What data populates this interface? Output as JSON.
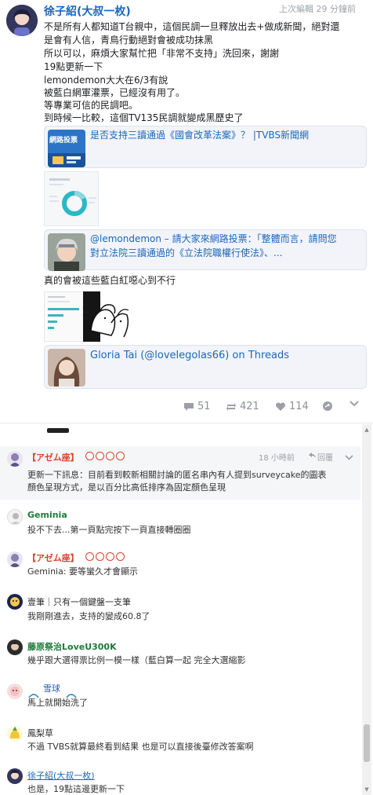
{
  "post": {
    "author": "徐子紹(大叔一枚)",
    "edited": "上次編輯 29 分鐘前",
    "lines": [
      "不是所有人都知道T台親中，這個民調一旦釋放出去+做成新聞，絕對還",
      "是會有人信，青鳥行動絕對會被成功抹黑",
      "所以可以，麻煩大家幫忙把「非常不支持」洗回來，謝謝",
      "19點更新一下",
      "lemondemon大大在6/3有說",
      "被藍白網軍灌票，已經沒有用了。",
      "等專業可信的民調吧。",
      "到時候一比較，這個TV135民調就變成黑歷史了"
    ],
    "previews": [
      {
        "title": "是否支持三讀通過《國會改革法案》？ |TVBS新聞網",
        "thumb_label": "網路投票"
      },
      {
        "title_line1": "@lemondemon – 請大家來網路投票：「整體而言，請問您",
        "title_line2": "對立法院三讀通過的《立法院職權行使法》、..."
      },
      {
        "title": "Gloria Tai (@lovelegolas66) on Threads"
      }
    ],
    "caption": "真的會被這些藍白紅噁心到不行",
    "stats": {
      "comments": "51",
      "reposts": "421",
      "likes": "114"
    }
  },
  "comments": [
    {
      "name": "【アゼム座】",
      "time": "18 小時前",
      "reply": "回覆",
      "text1": "更新一下訊息：目前看到較新相關討論的匿名串內有人提到surveycake的圖表",
      "text2": "顏色呈現方式，是以百分比高低排序為固定顏色呈現"
    },
    {
      "name": "Geminia",
      "text1": "投不下去...第一頁點完按下一頁直接轉圈圈"
    },
    {
      "name": "【アゼム座】",
      "text1": "Geminia: 要等蠻久才會顯示"
    },
    {
      "name": "壹筆｜只有一個鍵盤一支筆",
      "text1": "我剛剛進去，支持的變成60.8了"
    },
    {
      "name": "藤原祭治LoveU300K",
      "text1": "幾乎跟大選得票比例一模一樣（藍白算一起 完全大選縮影"
    },
    {
      "name": "雪球",
      "text1": "馬上就開始洗了"
    },
    {
      "name": "鳳梨草",
      "text1": "不過 TVBS就算最終看到結果 也是可以直接後臺修改答案啊"
    },
    {
      "name": "徐子紹(大叔一枚)",
      "text1": "也是，19點這邊更新一下"
    }
  ],
  "colors": {
    "link": "#1c67b8",
    "red_name": "#d8422c",
    "green_name": "#1f7a3b",
    "muted": "#9b9ea4"
  },
  "icons": [
    "comment-icon",
    "repost-icon",
    "heart-icon",
    "share-icon",
    "chevron-down-icon",
    "reply-icon"
  ]
}
